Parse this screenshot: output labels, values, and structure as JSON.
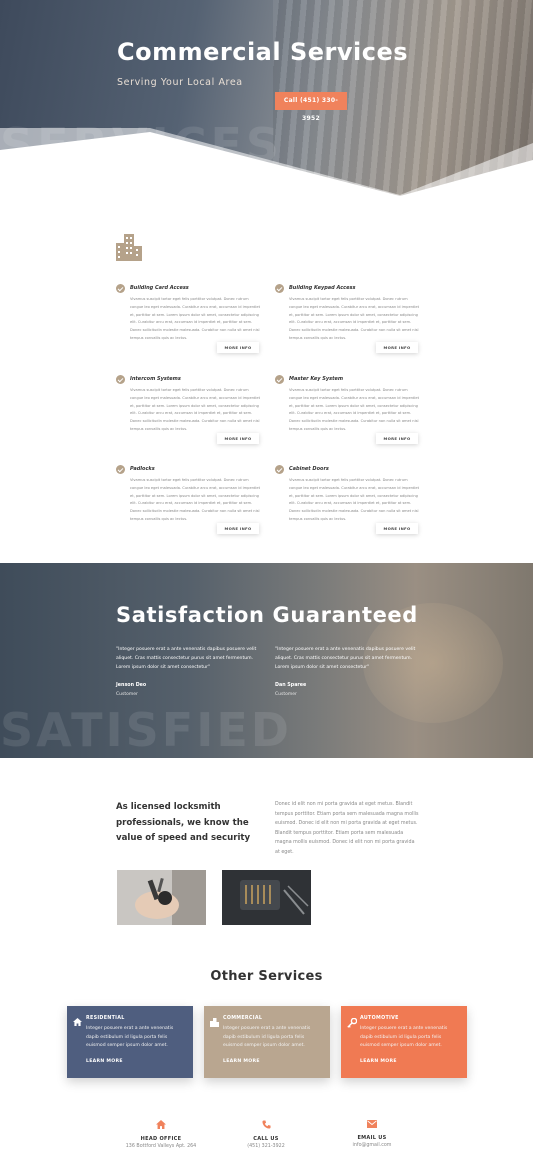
{
  "hero": {
    "title": "Commercial Services",
    "subtitle": "Serving Your Local Area",
    "cta": "Call (451) 330-3952",
    "ghost_text": "SERVICES"
  },
  "services": [
    {
      "title": "Building Card Access",
      "text": "Vivamus suscipit tortor eget felis porttitor volutpat. Donec rutrum congue leo eget malesuada. Curabitur arcu erat, accumsan id imperdiet et, porttitor at sem. Lorem ipsum dolor sit amet, consectetur adipiscing elit. Curabitur arcu erat, accumsan id imperdiet et, porttitor at sem. Donec sollicitudin molestie malesuada. Curabitur non nulla sit amet nisl tempus convallis quis ac lectus.",
      "button": "MORE INFO"
    },
    {
      "title": "Building Keypad Access",
      "text": "Vivamus suscipit tortor eget felis porttitor volutpat. Donec rutrum congue leo eget malesuada. Curabitur arcu erat, accumsan id imperdiet et, porttitor at sem. Lorem ipsum dolor sit amet, consectetur adipiscing elit. Curabitur arcu erat, accumsan id imperdiet et, porttitor at sem. Donec sollicitudin molestie malesuada. Curabitur non nulla sit amet nisl tempus convallis quis ac lectus.",
      "button": "MORE INFO"
    },
    {
      "title": "Intercom Systems",
      "text": "Vivamus suscipit tortor eget felis porttitor volutpat. Donec rutrum congue leo eget malesuada. Curabitur arcu erat, accumsan id imperdiet et, porttitor at sem. Lorem ipsum dolor sit amet, consectetur adipiscing elit. Curabitur arcu erat, accumsan id imperdiet et, porttitor at sem. Donec sollicitudin molestie malesuada. Curabitur non nulla sit amet nisl tempus convallis quis ac lectus.",
      "button": "MORE INFO"
    },
    {
      "title": "Master Key System",
      "text": "Vivamus suscipit tortor eget felis porttitor volutpat. Donec rutrum congue leo eget malesuada. Curabitur arcu erat, accumsan id imperdiet et, porttitor at sem. Lorem ipsum dolor sit amet, consectetur adipiscing elit. Curabitur arcu erat, accumsan id imperdiet et, porttitor at sem. Donec sollicitudin molestie malesuada. Curabitur non nulla sit amet nisl tempus convallis quis ac lectus.",
      "button": "MORE INFO"
    },
    {
      "title": "Padlocks",
      "text": "Vivamus suscipit tortor eget felis porttitor volutpat. Donec rutrum congue leo eget malesuada. Curabitur arcu erat, accumsan id imperdiet et, porttitor at sem. Lorem ipsum dolor sit amet, consectetur adipiscing elit. Curabitur arcu erat, accumsan id imperdiet et, porttitor at sem. Donec sollicitudin molestie malesuada. Curabitur non nulla sit amet nisl tempus convallis quis ac lectus.",
      "button": "MORE INFO"
    },
    {
      "title": "Cabinet Doors",
      "text": "Vivamus suscipit tortor eget felis porttitor volutpat. Donec rutrum congue leo eget malesuada. Curabitur arcu erat, accumsan id imperdiet et, porttitor at sem. Lorem ipsum dolor sit amet, consectetur adipiscing elit. Curabitur arcu erat, accumsan id imperdiet et, porttitor at sem. Donec sollicitudin molestie malesuada. Curabitur non nulla sit amet nisl tempus convallis quis ac lectus.",
      "button": "MORE INFO"
    }
  ],
  "satisfaction": {
    "title": "Satisfaction Guaranteed",
    "ghost_text": "SATISFIED",
    "testimonials": [
      {
        "quote": "\"Integer posuere erat a ante venenatis dapibus posuere velit aliquet. Cras mattis consectetur purus sit amet fermentum. Lorem ipsum dolor sit amet consectetur\"",
        "name": "Jenson Deo",
        "role": "Customer"
      },
      {
        "quote": "\"Integer posuere erat a ante venenatis dapibus posuere velit aliquet. Cras mattis consectetur purus sit amet fermentum. Lorem ipsum dolor sit amet consectetur\"",
        "name": "Dan Sparee",
        "role": "Customer"
      }
    ]
  },
  "locksmith": {
    "heading": "As licensed locksmith professionals, we know the value of speed and security",
    "text": "Donec id elit non mi porta gravida at eget metus. Blandit tempus porttitor. Etiam porta sem malesuada magna mollis euismod. Donec id elit non mi porta gravida at eget metus. Blandit tempus porttitor. Etiam porta sem malesuada magna mollis euismod. Donec id elit non mi porta gravida at eget."
  },
  "other_services": {
    "title": "Other Services",
    "cards": [
      {
        "title": "RESIDENTIAL",
        "icon": "home-icon",
        "color": "#4f5e7f",
        "text": "Integer posuere erat a ante venenatis dapib estibulum id ligula porta felis euismod semper ipsum dolor amet.",
        "link": "LEARN MORE"
      },
      {
        "title": "COMMERCIAL",
        "icon": "building-icon",
        "color": "#b9a690",
        "text": "Integer posuere erat a ante venenatis dapib estibulum id ligula porta felis euismod semper ipsum dolor amet.",
        "link": "LEARN MORE"
      },
      {
        "title": "AUTOMOTIVE",
        "icon": "key-icon",
        "color": "#f07a53",
        "text": "Integer posuere erat a ante venenatis dapib estibulum id ligula porta felis euismod semper ipsum dolor amet.",
        "link": "LEARN MORE"
      }
    ]
  },
  "footer": [
    {
      "icon": "home-icon",
      "label": "HEAD OFFICE",
      "value": "136 Bottford Valleys Apt. 264"
    },
    {
      "icon": "phone-icon",
      "label": "CALL US",
      "value": "(451) 321-3922"
    },
    {
      "icon": "mail-icon",
      "label": "EMAIL US",
      "value": "info@gmail.com"
    }
  ],
  "colors": {
    "accent": "#f0825c",
    "tan": "#b5a28a",
    "navy": "#4f5e7f"
  }
}
